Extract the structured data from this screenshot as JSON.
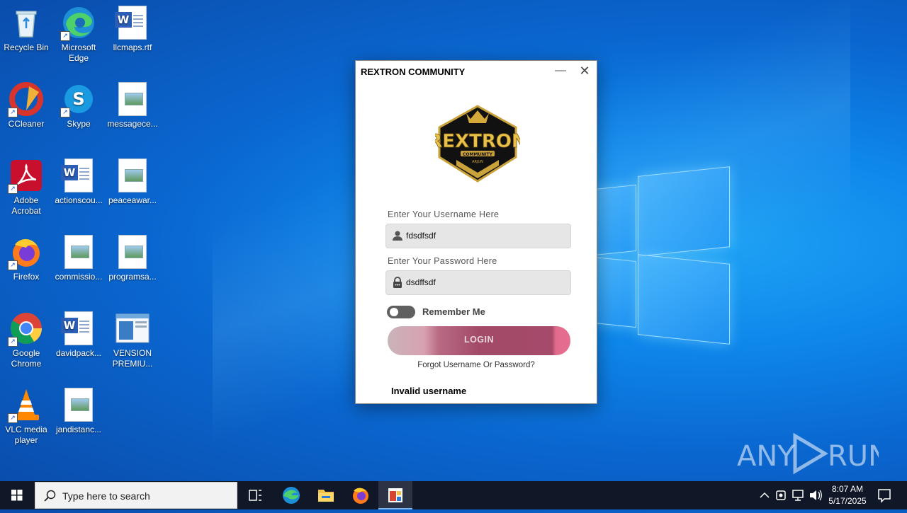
{
  "desktop": {
    "icons": [
      {
        "label": "Recycle Bin"
      },
      {
        "label": "Microsoft Edge"
      },
      {
        "label": "llcmaps.rtf"
      },
      {
        "label": "CCleaner"
      },
      {
        "label": "Skype"
      },
      {
        "label": "messagece..."
      },
      {
        "label": "Adobe Acrobat"
      },
      {
        "label": "actionscou..."
      },
      {
        "label": "peaceawar..."
      },
      {
        "label": "Firefox"
      },
      {
        "label": "commissio..."
      },
      {
        "label": "programsa..."
      },
      {
        "label": "Google Chrome"
      },
      {
        "label": "davidpack..."
      },
      {
        "label": "VENSION PREMIU..."
      },
      {
        "label": "VLC media player"
      },
      {
        "label": "jandistanc..."
      }
    ]
  },
  "dialog": {
    "title": "REXTRON COMMUNITY",
    "logo_text": "REXTRON",
    "logo_sub": "COMMUNITY",
    "logo_sub2": "ARJUN",
    "username_label": "Enter Your Username Here",
    "username_value": "fdsdfsdf",
    "password_label": "Enter Your Password Here",
    "password_value": "dsdffsdf",
    "remember_label": "Remember Me",
    "remember_checked": false,
    "login_label": "LOGIN",
    "forgot_label": "Forgot Username Or Password?",
    "error_text": "Invalid username"
  },
  "watermark": "ANY RUN",
  "taskbar": {
    "search_placeholder": "Type here to search",
    "time": "8:07 AM",
    "date": "5/17/2025"
  },
  "colors": {
    "login_accent": "#a24a68",
    "taskbar_bg": "#101726",
    "desktop_blue": "#0a67d0"
  }
}
